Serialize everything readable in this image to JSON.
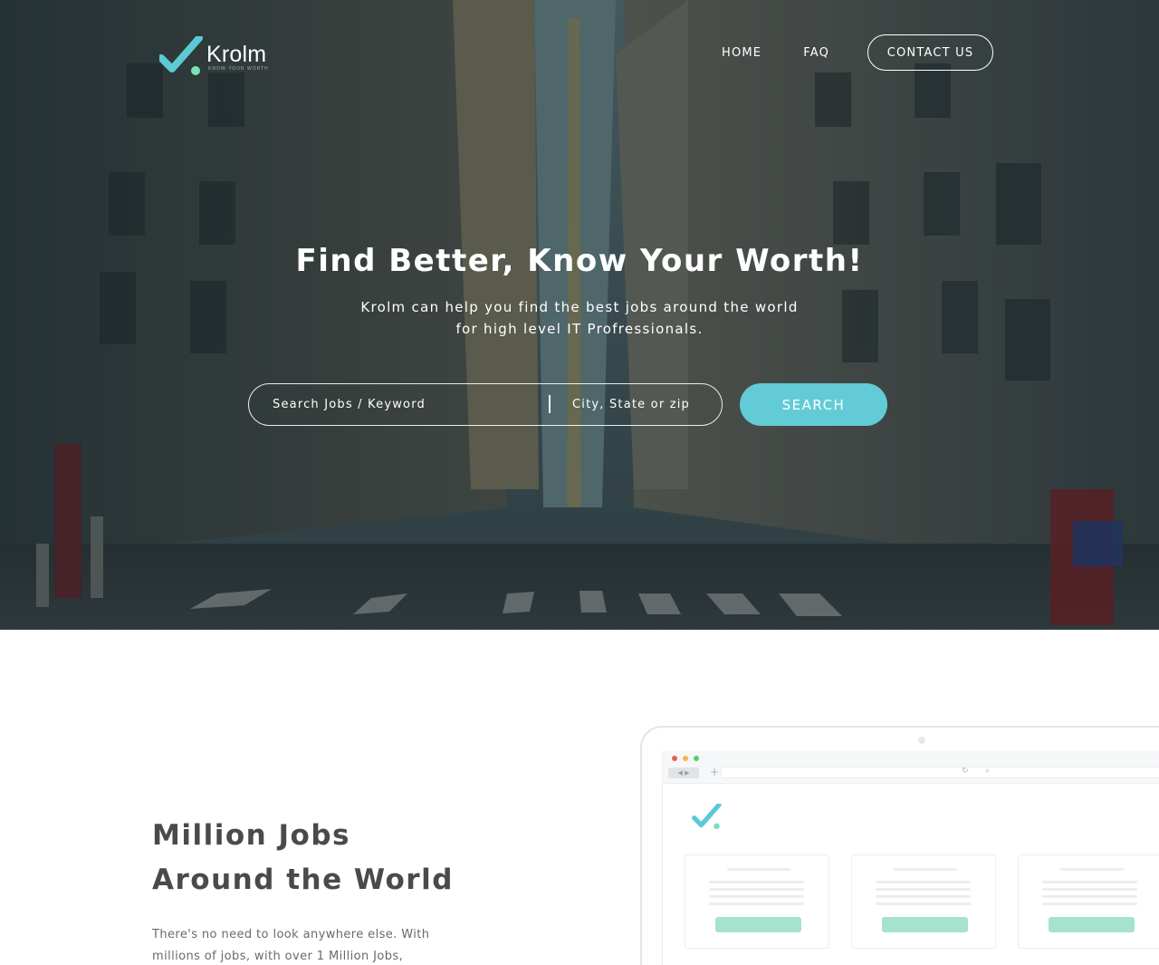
{
  "brand": {
    "name": "Krolm",
    "tagline": "KNOW YOUR WORTH",
    "accent_color": "#63cbd6",
    "logo_icon": "checkmark-icon"
  },
  "nav": {
    "items": [
      {
        "label": "HOME"
      },
      {
        "label": "FAQ"
      }
    ],
    "contact_label": "CONTACT US"
  },
  "hero": {
    "title": "Find Better, Know Your Worth!",
    "subtitle_line1": "Krolm can help you find the best jobs around the world",
    "subtitle_line2": "for high level IT Profressionals.",
    "search": {
      "keyword_placeholder": "Search Jobs / Keyword",
      "location_placeholder": "City, State or zip",
      "button_label": "SEARCH"
    }
  },
  "feature": {
    "title_line1": "Million Jobs",
    "title_line2": "Around the World",
    "body_line1": "There's no need to look anywhere else. With",
    "body_line2": "millions of jobs, with over 1 Million Jobs,"
  },
  "mockup": {
    "window_dots": [
      "#e8604c",
      "#f4b63f",
      "#5ccb6b"
    ],
    "card_button_color": "#a5e3cc"
  }
}
